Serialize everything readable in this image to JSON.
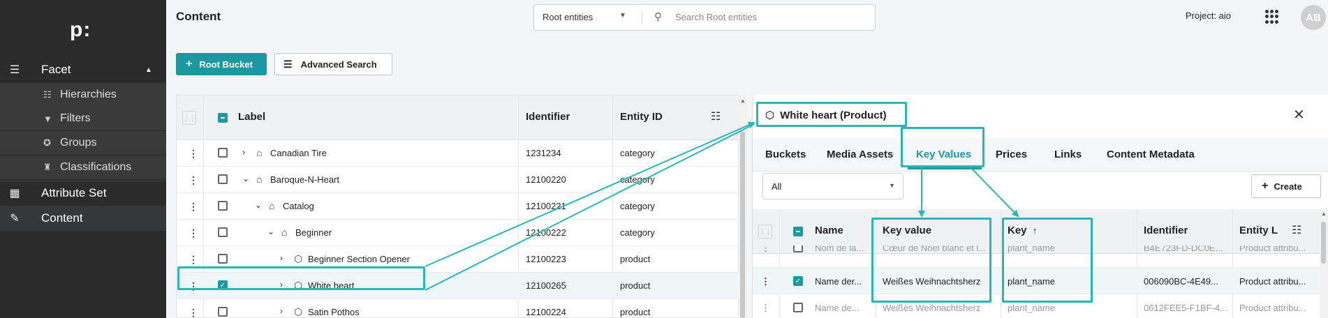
{
  "sidebar": {
    "logo": "p:",
    "items": [
      {
        "label": "Facet",
        "icon": "facet-icon",
        "expanded": true
      },
      {
        "label": "Attribute Set",
        "icon": "attribute-set-icon"
      },
      {
        "label": "Content",
        "icon": "content-icon",
        "active": true
      }
    ],
    "sub_items": [
      {
        "label": "Hierarchies",
        "icon": "hierarchy-icon"
      },
      {
        "label": "Filters",
        "icon": "filter-icon"
      },
      {
        "label": "Groups",
        "icon": "groups-icon"
      },
      {
        "label": "Classifications",
        "icon": "classification-icon"
      }
    ]
  },
  "header": {
    "title": "Content",
    "scope_select": "Root entities",
    "search_placeholder": "Search Root entities",
    "project": "Project: aio",
    "avatar": "AB"
  },
  "toolbar": {
    "root_bucket_label": "Root Bucket",
    "advanced_search_label": "Advanced Search"
  },
  "left_table": {
    "columns": [
      "Label",
      "Identifier",
      "Entity ID"
    ],
    "rows": [
      {
        "label": "Canadian Tire",
        "identifier": "1231234",
        "entity": "category",
        "depth": 0,
        "chevron": "›",
        "icon": "⌂",
        "checked": false
      },
      {
        "label": "Baroque-N-Heart",
        "identifier": "12100220",
        "entity": "category",
        "depth": 0,
        "chevron": "⌄",
        "icon": "⌂",
        "checked": false
      },
      {
        "label": "Catalog",
        "identifier": "12100221",
        "entity": "category",
        "depth": 1,
        "chevron": "⌄",
        "icon": "⌂",
        "checked": false
      },
      {
        "label": "Beginner",
        "identifier": "12100222",
        "entity": "category",
        "depth": 2,
        "chevron": "⌄",
        "icon": "⌂",
        "checked": false
      },
      {
        "label": "Beginner Section Opener",
        "identifier": "12100223",
        "entity": "product",
        "depth": 3,
        "chevron": "›",
        "icon": "⬡",
        "checked": false
      },
      {
        "label": "White heart",
        "identifier": "12100265",
        "entity": "product",
        "depth": 3,
        "chevron": "›",
        "icon": "⬡",
        "checked": true
      },
      {
        "label": "Satin Pothos",
        "identifier": "12100224",
        "entity": "product",
        "depth": 3,
        "chevron": "›",
        "icon": "⬡",
        "checked": false
      }
    ]
  },
  "detail": {
    "title": "White heart (Product)",
    "tabs": [
      "Buckets",
      "Media Assets",
      "Key Values",
      "Prices",
      "Links",
      "Content Metadata"
    ],
    "active_tab": "Key Values",
    "filter_value": "All",
    "create_label": "Create",
    "columns": [
      "Name",
      "Key value",
      "Key",
      "Identifier",
      "Entity L"
    ],
    "sort_indicator": "↑",
    "rows": [
      {
        "name": "Nom de la...",
        "key_value": "Cœur de Noël blanc et l...",
        "key": "plant_name",
        "identifier": "B4E723FD-DC0E...",
        "entity": "Product attribu...",
        "checked": false,
        "clipped": true
      },
      {
        "name": "Name der...",
        "key_value": "Weißes Weihnachtsherz",
        "key": "plant_name",
        "identifier": "006090BC-4E49...",
        "entity": "Product attribu...",
        "checked": true,
        "clipped": false
      },
      {
        "name": "Name de...",
        "key_value": "Weißes Weihnachtsherz",
        "key": "plant_name",
        "identifier": "0612FEE5-F1BF-4...",
        "entity": "Product attribu...",
        "checked": false,
        "clipped": true
      }
    ]
  },
  "colors": {
    "accent": "#1a9aa0",
    "highlight": "#27b7b9",
    "sidebar_bg": "#2b2b2b"
  }
}
